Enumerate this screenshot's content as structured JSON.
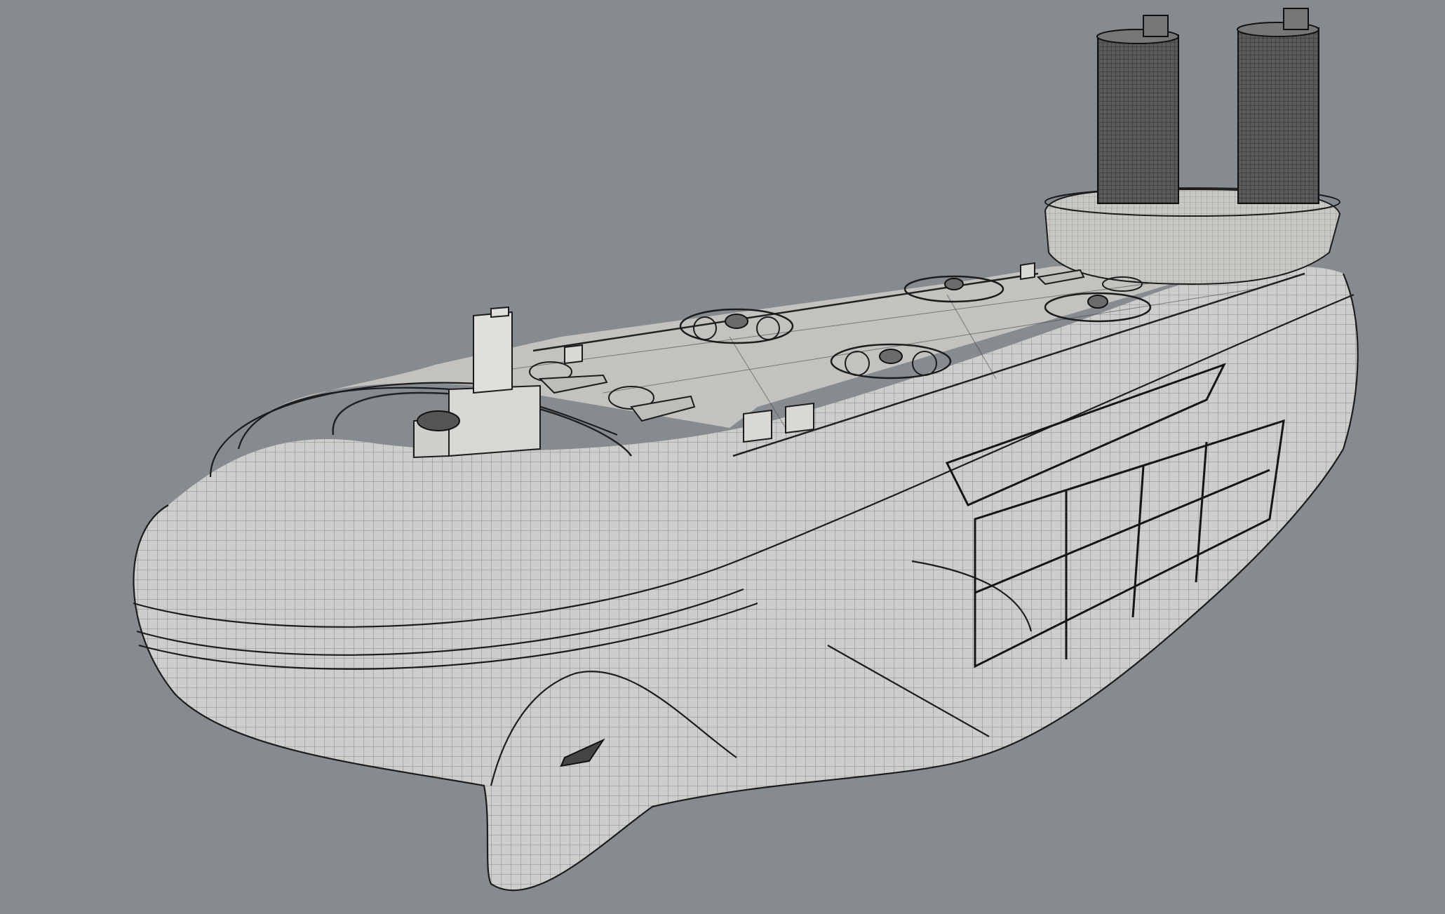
{
  "viewport": {
    "background_color": "#868b90",
    "display_mode": "wireframe-shaded"
  },
  "scene": {
    "object": "ship-hull",
    "components": [
      "hull",
      "bow-bulb",
      "flight-deck",
      "bridge-tower",
      "funnel-left",
      "funnel-right",
      "funnel-base",
      "drone",
      "vtol-aircraft",
      "deck-hut",
      "side-panel-grid",
      "deck-railing"
    ],
    "drone_count": 4,
    "vtol_count": 4,
    "funnel_count": 2,
    "colors": {
      "hull": "#cdcdcb",
      "deck": "#c3c2bf",
      "wire": "#1c1c1c",
      "tower": "#e0dfdc",
      "funnel": "#4a4a4a"
    }
  }
}
